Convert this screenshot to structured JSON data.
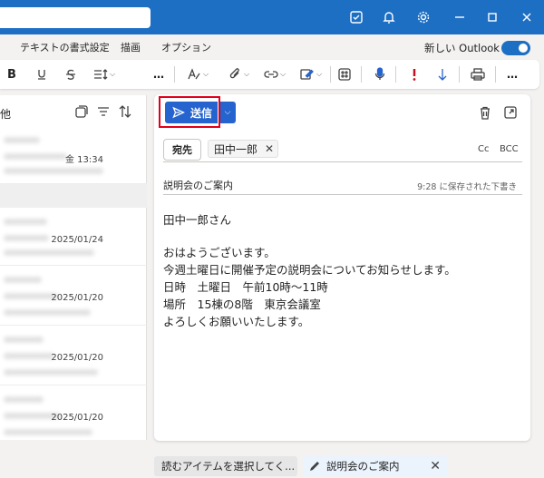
{
  "menubar": {
    "items": [
      "テキストの書式設定",
      "描画",
      "オプション"
    ],
    "new_outlook_label": "新しい Outlook"
  },
  "ribbon": {
    "bold_label": "B",
    "more_label": "…"
  },
  "list": {
    "header_label": "他",
    "rows": [
      {
        "date": "金 13:34"
      },
      {
        "date": "2025/01/24"
      },
      {
        "date": "2025/01/20"
      },
      {
        "date": "2025/01/20"
      },
      {
        "date": "2025/01/20"
      }
    ]
  },
  "compose": {
    "send_label": "送信",
    "to_label": "宛先",
    "recipient": "田中一郎",
    "cc_label": "Cc",
    "bcc_label": "BCC",
    "subject": "説明会のご案内",
    "saved_status": "9:28 に保存された下書き",
    "body_lines": [
      "田中一郎さん",
      "",
      "おはようございます。",
      "今週土曜日に開催予定の説明会についてお知らせします。",
      "日時　土曜日　午前10時～11時",
      "場所　15棟の8階　東京会議室",
      "よろしくお願いいたします。"
    ]
  },
  "bottom_tabs": {
    "tab1": "読むアイテムを選択してく...",
    "tab2": "説明会のご案内",
    "close": "✕"
  },
  "colors": {
    "accent": "#1d6fc4",
    "send_button": "#2564cf",
    "highlight": "#e0001b"
  }
}
